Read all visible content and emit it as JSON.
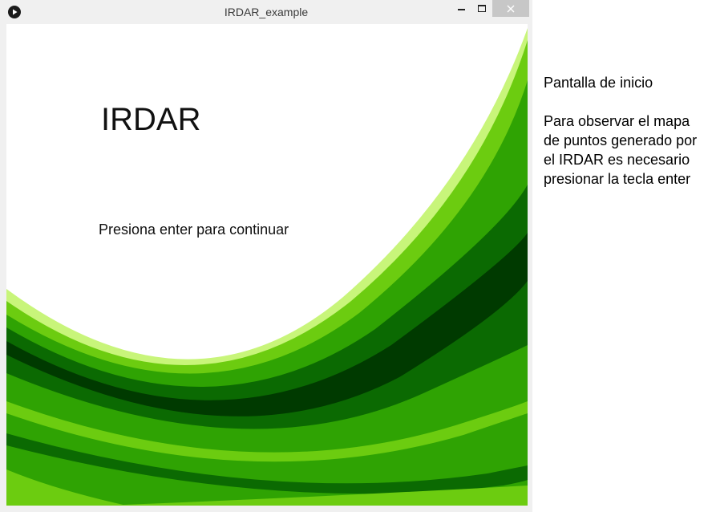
{
  "window": {
    "title": "IRDAR_example",
    "app_icon": "play-icon",
    "controls": {
      "minimize_icon": "minimize-icon",
      "maximize_icon": "maximize-icon",
      "close_icon": "close-icon"
    }
  },
  "canvas": {
    "title": "IRDAR",
    "prompt": "Presiona enter para continuar",
    "colors": {
      "background": "#ffffff",
      "light_green": "#c8f57a",
      "bright_green": "#6ccc10",
      "mid_green": "#2fa303",
      "dark_green": "#0b6a02",
      "darkest_green": "#003a00"
    }
  },
  "description": {
    "heading": "Pantalla de inicio",
    "body": "Para observar el mapa de puntos generado por el IRDAR es necesario presionar la tecla enter"
  }
}
